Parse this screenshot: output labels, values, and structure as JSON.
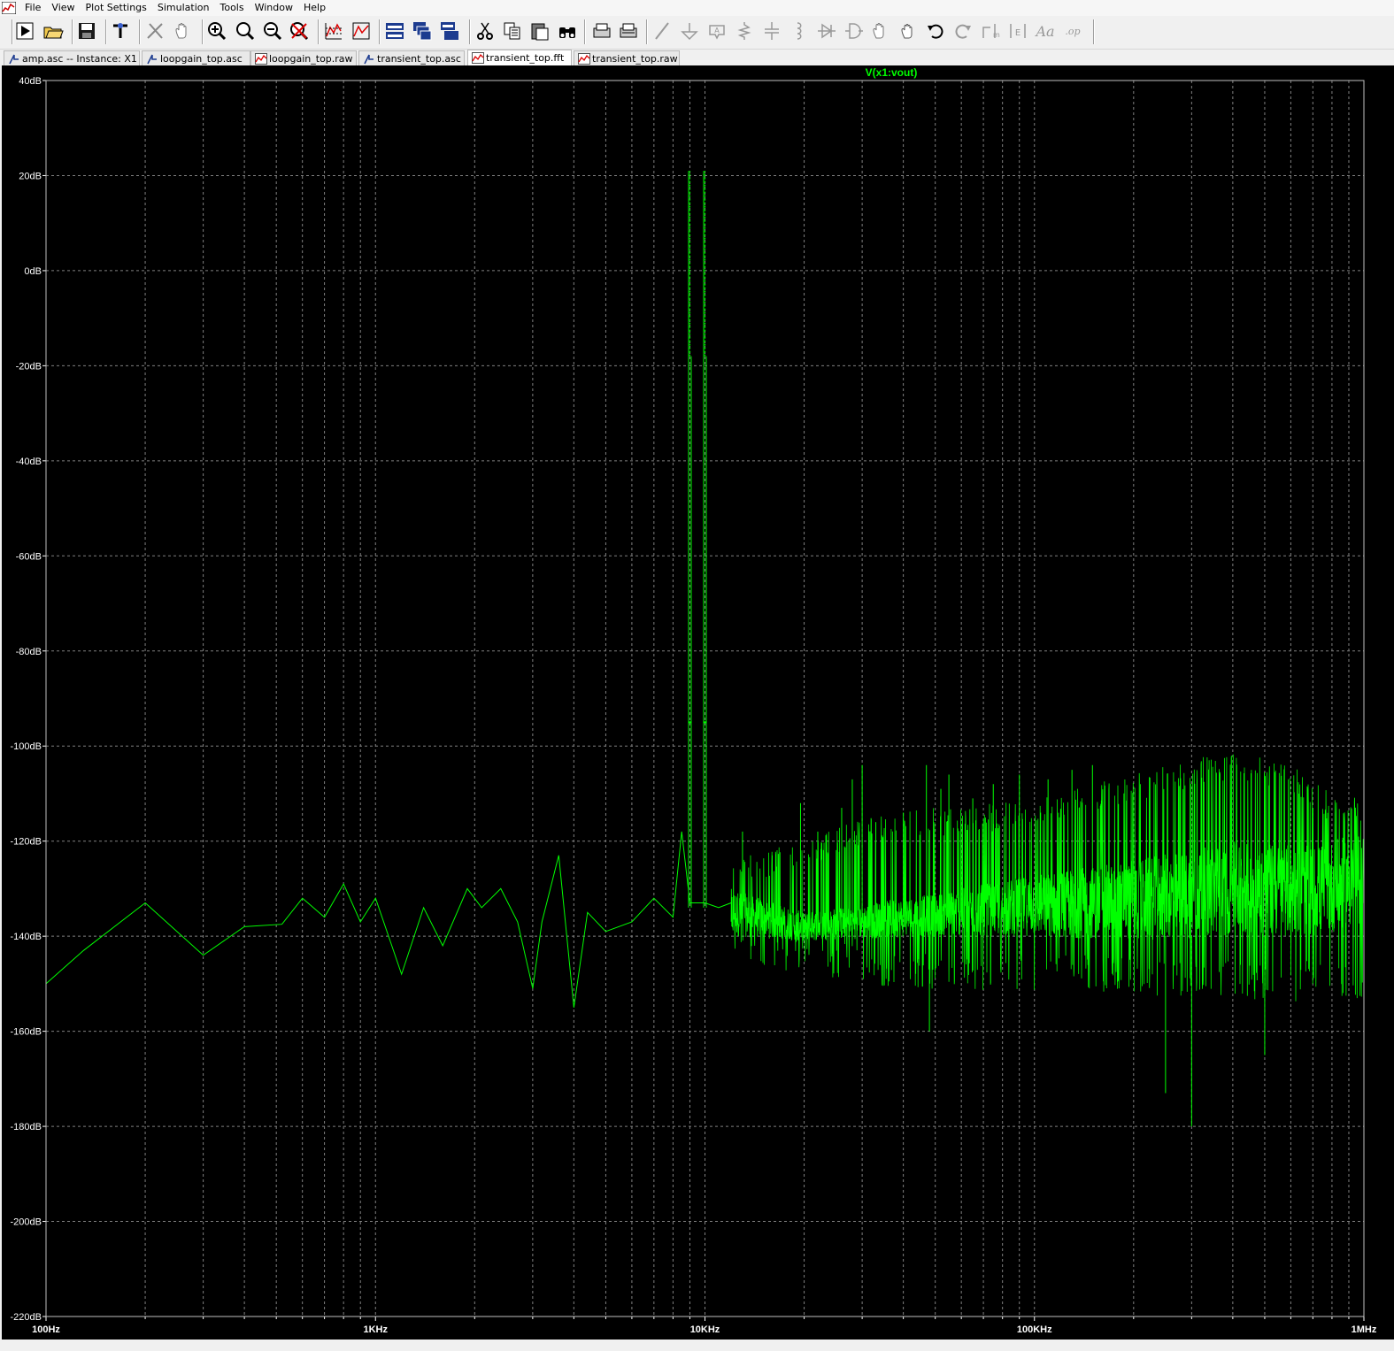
{
  "menu": {
    "items": [
      {
        "label": "File"
      },
      {
        "label": "View"
      },
      {
        "label": "Plot Settings"
      },
      {
        "label": "Simulation"
      },
      {
        "label": "Tools"
      },
      {
        "label": "Window"
      },
      {
        "label": "Help"
      }
    ]
  },
  "toolbar": {
    "buttons": [
      {
        "icon": "run-icon"
      },
      {
        "icon": "open-icon"
      },
      {
        "icon": "save-icon"
      },
      {
        "icon": "control-panel-icon"
      },
      {
        "icon": "cut-wire-icon"
      },
      {
        "icon": "pan-icon"
      },
      {
        "icon": "zoom-in-icon"
      },
      {
        "icon": "zoom-fit-icon"
      },
      {
        "icon": "zoom-out-icon"
      },
      {
        "icon": "zoom-cancel-icon"
      },
      {
        "icon": "autoscale-icon"
      },
      {
        "icon": "plot-settings-icon"
      },
      {
        "icon": "tile-horizontal-icon"
      },
      {
        "icon": "cascade-icon"
      },
      {
        "icon": "tile-vertical-icon"
      },
      {
        "icon": "cut-icon"
      },
      {
        "icon": "copy-icon"
      },
      {
        "icon": "paste-icon"
      },
      {
        "icon": "find-icon"
      },
      {
        "icon": "print-icon"
      },
      {
        "icon": "print-setup-icon"
      },
      {
        "icon": "wire-icon"
      },
      {
        "icon": "ground-icon"
      },
      {
        "icon": "label-icon"
      },
      {
        "icon": "resistor-icon"
      },
      {
        "icon": "capacitor-icon"
      },
      {
        "icon": "inductor-icon"
      },
      {
        "icon": "diode-icon"
      },
      {
        "icon": "component-icon"
      },
      {
        "icon": "move-icon"
      },
      {
        "icon": "drag-icon"
      },
      {
        "icon": "undo-icon"
      },
      {
        "icon": "redo-icon"
      },
      {
        "icon": "rotate-icon"
      },
      {
        "icon": "mirror-icon"
      },
      {
        "icon": "text-icon"
      },
      {
        "icon": "spice-directive-icon"
      }
    ]
  },
  "tabs": [
    {
      "label": "amp.asc -- Instance: X1",
      "kind": "schematic"
    },
    {
      "label": "loopgain_top.asc",
      "kind": "schematic"
    },
    {
      "label": "loopgain_top.raw",
      "kind": "waveform"
    },
    {
      "label": "transient_top.asc",
      "kind": "schematic"
    },
    {
      "label": "transient_top.fft",
      "kind": "waveform",
      "active": true
    },
    {
      "label": "transient_top.raw",
      "kind": "waveform"
    }
  ],
  "chart_data": {
    "type": "line",
    "title": "V(x1:vout)",
    "xscale": "log",
    "xlim": [
      100,
      1000000
    ],
    "ylim": [
      -220,
      40
    ],
    "x_tick_labels": [
      "100Hz",
      "1KHz",
      "10KHz",
      "100KHz",
      "1MHz"
    ],
    "y_tick_labels": [
      "40dB",
      "20dB",
      "0dB",
      "-20dB",
      "-40dB",
      "-60dB",
      "-80dB",
      "-100dB",
      "-120dB",
      "-140dB",
      "-160dB",
      "-180dB",
      "-200dB",
      "-220dB"
    ],
    "grid": true,
    "colors": {
      "background": "#000000",
      "trace": "#00ff00",
      "grid": "#808080",
      "axis_text": "#ffffff",
      "title": "#00ff00"
    },
    "series": [
      {
        "name": "V(x1:vout)",
        "peaks": [
          {
            "x": 9000,
            "y": 21
          },
          {
            "x": 10000,
            "y": 21
          }
        ],
        "low_freq_trace": [
          [
            100,
            -150
          ],
          [
            130,
            -143
          ],
          [
            200,
            -133
          ],
          [
            300,
            -144
          ],
          [
            400,
            -138
          ],
          [
            520,
            -137.5
          ],
          [
            600,
            -132
          ],
          [
            700,
            -136
          ],
          [
            800,
            -129
          ],
          [
            900,
            -137
          ],
          [
            1000,
            -132
          ],
          [
            1200,
            -148
          ],
          [
            1400,
            -134
          ],
          [
            1600,
            -142
          ],
          [
            1900,
            -130
          ],
          [
            2100,
            -134
          ],
          [
            2400,
            -130
          ],
          [
            2700,
            -137
          ],
          [
            3000,
            -151
          ],
          [
            3200,
            -137
          ],
          [
            3600,
            -123
          ],
          [
            4000,
            -155
          ],
          [
            4400,
            -135
          ],
          [
            5000,
            -139
          ],
          [
            6000,
            -137
          ],
          [
            7000,
            -132
          ],
          [
            8000,
            -136
          ],
          [
            8500,
            -118
          ],
          [
            9000,
            -133
          ],
          [
            10000,
            -133
          ],
          [
            11000,
            -134
          ],
          [
            12000,
            -133
          ]
        ],
        "envelope_upper": [
          [
            12000,
            -123
          ],
          [
            20000,
            -120
          ],
          [
            30000,
            -115
          ],
          [
            50000,
            -113
          ],
          [
            80000,
            -112
          ],
          [
            150000,
            -108
          ],
          [
            250000,
            -104
          ],
          [
            400000,
            -101
          ],
          [
            600000,
            -104
          ],
          [
            800000,
            -110
          ],
          [
            1000000,
            -110
          ]
        ],
        "envelope_lower": [
          [
            12000,
            -145
          ],
          [
            20000,
            -148
          ],
          [
            30000,
            -150
          ],
          [
            50000,
            -152
          ],
          [
            80000,
            -152
          ],
          [
            150000,
            -152
          ],
          [
            250000,
            -153
          ],
          [
            400000,
            -153
          ],
          [
            600000,
            -154
          ],
          [
            800000,
            -152
          ],
          [
            1000000,
            -155
          ]
        ],
        "dense_band_upper": [
          [
            20000,
            -135
          ],
          [
            50000,
            -131
          ],
          [
            100000,
            -127
          ],
          [
            200000,
            -124
          ],
          [
            400000,
            -120
          ],
          [
            700000,
            -121
          ],
          [
            1000000,
            -118
          ]
        ],
        "dense_band_lower": [
          [
            20000,
            -141
          ],
          [
            50000,
            -140
          ],
          [
            100000,
            -140
          ],
          [
            200000,
            -141
          ],
          [
            400000,
            -140
          ],
          [
            700000,
            -140
          ],
          [
            1000000,
            -138
          ]
        ],
        "notable_dips": [
          [
            48000,
            -160
          ],
          [
            250000,
            -173
          ],
          [
            300000,
            -180
          ],
          [
            500000,
            -165
          ]
        ]
      }
    ]
  }
}
